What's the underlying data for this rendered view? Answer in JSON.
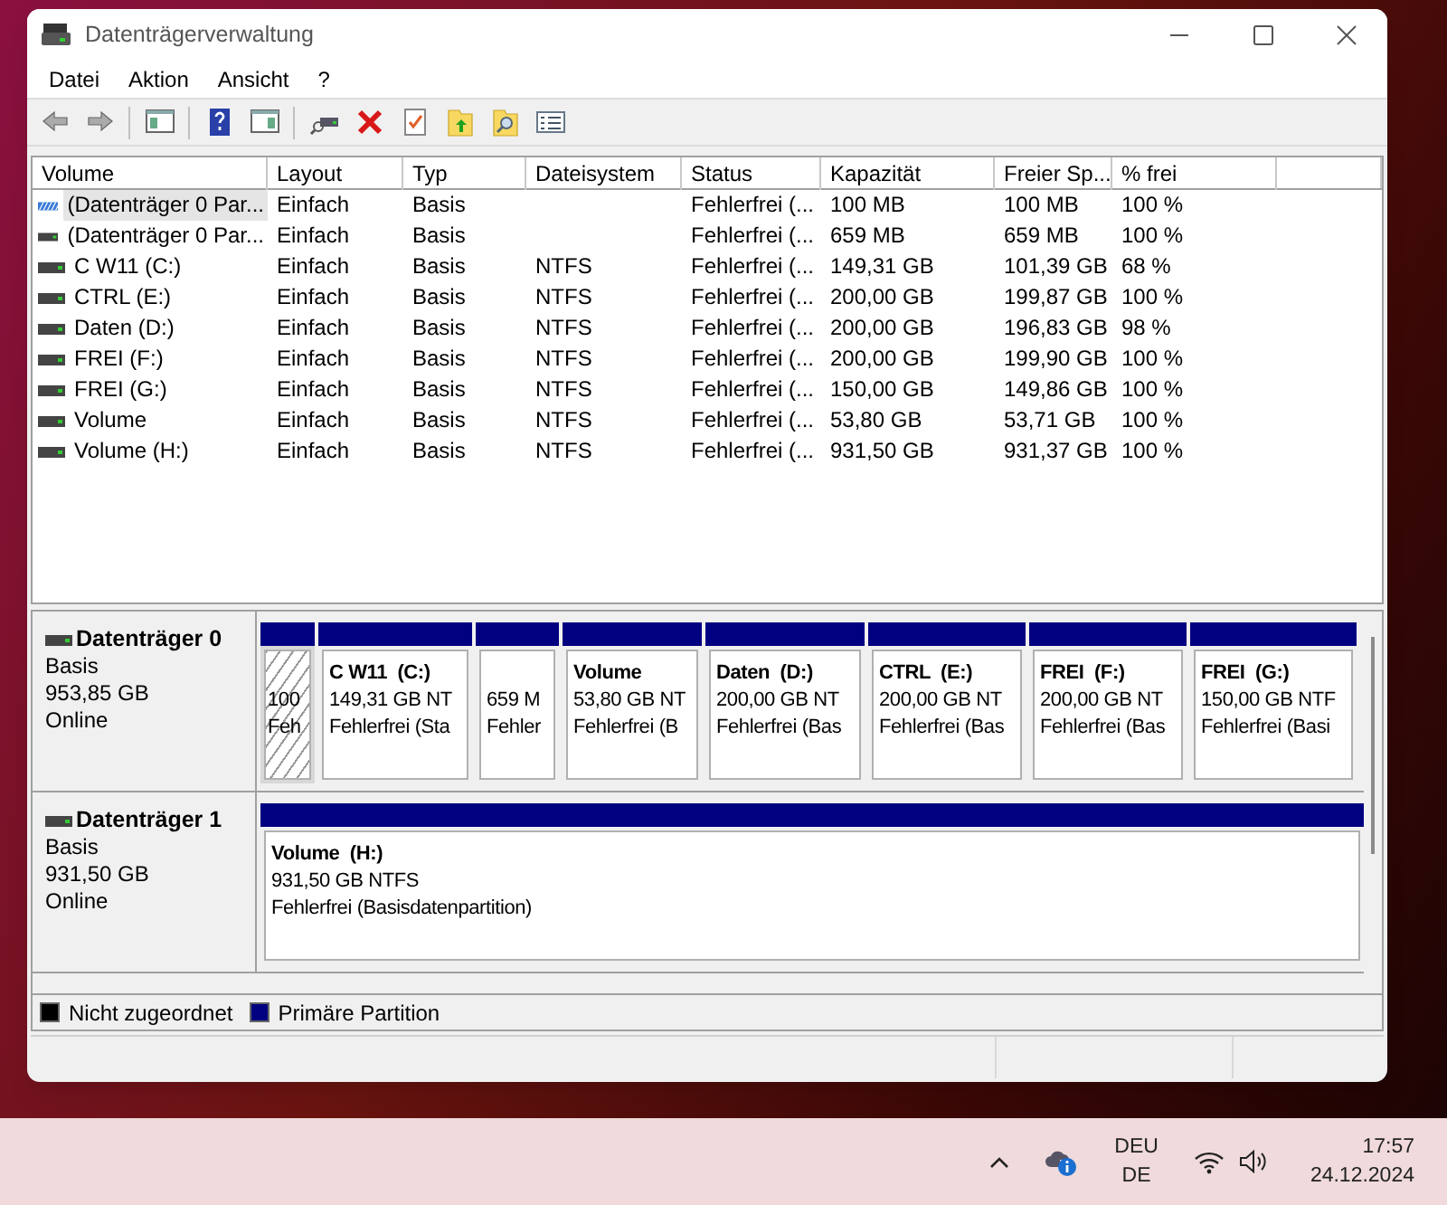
{
  "window": {
    "title": "Datenträgerverwaltung"
  },
  "menu": [
    "Datei",
    "Aktion",
    "Ansicht",
    "?"
  ],
  "toolbar": [
    {
      "kind": "back",
      "disabled": true
    },
    {
      "kind": "forward",
      "disabled": true
    },
    {
      "kind": "sep"
    },
    {
      "kind": "tree"
    },
    {
      "kind": "sep"
    },
    {
      "kind": "help"
    },
    {
      "kind": "pane"
    },
    {
      "kind": "sep"
    },
    {
      "kind": "connect"
    },
    {
      "kind": "delete"
    },
    {
      "kind": "check"
    },
    {
      "kind": "folder-up"
    },
    {
      "kind": "folder-search"
    },
    {
      "kind": "list"
    }
  ],
  "table": {
    "columns": [
      "Volume",
      "Layout",
      "Typ",
      "Dateisystem",
      "Status",
      "Kapazität",
      "Freier Sp...",
      "% frei"
    ],
    "rows": [
      {
        "selected": true,
        "cells": [
          "(Datenträger 0 Par...",
          "Einfach",
          "Basis",
          "",
          "Fehlerfrei (...",
          "100 MB",
          "100 MB",
          "100 %"
        ]
      },
      {
        "selected": false,
        "cells": [
          "(Datenträger 0 Par...",
          "Einfach",
          "Basis",
          "",
          "Fehlerfrei (...",
          "659 MB",
          "659 MB",
          "100 %"
        ]
      },
      {
        "selected": false,
        "cells": [
          "C W11 (C:)",
          "Einfach",
          "Basis",
          "NTFS",
          "Fehlerfrei (...",
          "149,31 GB",
          "101,39 GB",
          "68 %"
        ]
      },
      {
        "selected": false,
        "cells": [
          "CTRL (E:)",
          "Einfach",
          "Basis",
          "NTFS",
          "Fehlerfrei (...",
          "200,00 GB",
          "199,87 GB",
          "100 %"
        ]
      },
      {
        "selected": false,
        "cells": [
          "Daten (D:)",
          "Einfach",
          "Basis",
          "NTFS",
          "Fehlerfrei (...",
          "200,00 GB",
          "196,83 GB",
          "98 %"
        ]
      },
      {
        "selected": false,
        "cells": [
          "FREI (F:)",
          "Einfach",
          "Basis",
          "NTFS",
          "Fehlerfrei (...",
          "200,00 GB",
          "199,90 GB",
          "100 %"
        ]
      },
      {
        "selected": false,
        "cells": [
          "FREI (G:)",
          "Einfach",
          "Basis",
          "NTFS",
          "Fehlerfrei (...",
          "150,00 GB",
          "149,86 GB",
          "100 %"
        ]
      },
      {
        "selected": false,
        "cells": [
          "Volume",
          "Einfach",
          "Basis",
          "NTFS",
          "Fehlerfrei (...",
          "53,80 GB",
          "53,71 GB",
          "100 %"
        ]
      },
      {
        "selected": false,
        "cells": [
          "Volume (H:)",
          "Einfach",
          "Basis",
          "NTFS",
          "Fehlerfrei (...",
          "931,50 GB",
          "931,37 GB",
          "100 %"
        ]
      }
    ]
  },
  "disks": [
    {
      "name": "Datenträger 0",
      "type": "Basis",
      "size": "953,85 GB",
      "state": "Online",
      "partitions": [
        {
          "selected": true,
          "lines": [
            "100",
            "Feh"
          ]
        },
        {
          "selected": false,
          "name": "C W11  (C:)",
          "lines": [
            "149,31 GB NT",
            "Fehlerfrei (Sta"
          ]
        },
        {
          "selected": false,
          "lines": [
            "659 M",
            "Fehler"
          ]
        },
        {
          "selected": false,
          "name": "Volume",
          "lines": [
            "53,80 GB NT",
            "Fehlerfrei (B"
          ]
        },
        {
          "selected": false,
          "name": "Daten  (D:)",
          "lines": [
            "200,00 GB NT",
            "Fehlerfrei (Bas"
          ]
        },
        {
          "selected": false,
          "name": "CTRL  (E:)",
          "lines": [
            "200,00 GB NT",
            "Fehlerfrei (Bas"
          ]
        },
        {
          "selected": false,
          "name": "FREI  (F:)",
          "lines": [
            "200,00 GB NT",
            "Fehlerfrei (Bas"
          ]
        },
        {
          "selected": false,
          "name": "FREI  (G:)",
          "lines": [
            "150,00 GB NTF",
            "Fehlerfrei (Basi"
          ]
        }
      ]
    },
    {
      "name": "Datenträger 1",
      "type": "Basis",
      "size": "931,50 GB",
      "state": "Online",
      "partitions": [
        {
          "selected": false,
          "name": "Volume  (H:)",
          "lines": [
            "931,50 GB NTFS",
            "Fehlerfrei (Basisdatenpartition)"
          ]
        }
      ]
    }
  ],
  "legend": [
    {
      "label": "Nicht zugeordnet",
      "color": "#000000"
    },
    {
      "label": "Primäre Partition",
      "color": "#000080"
    }
  ],
  "taskbar": {
    "language": "DEU",
    "layout": "DE",
    "time": "17:57",
    "date": "24.12.2024"
  }
}
